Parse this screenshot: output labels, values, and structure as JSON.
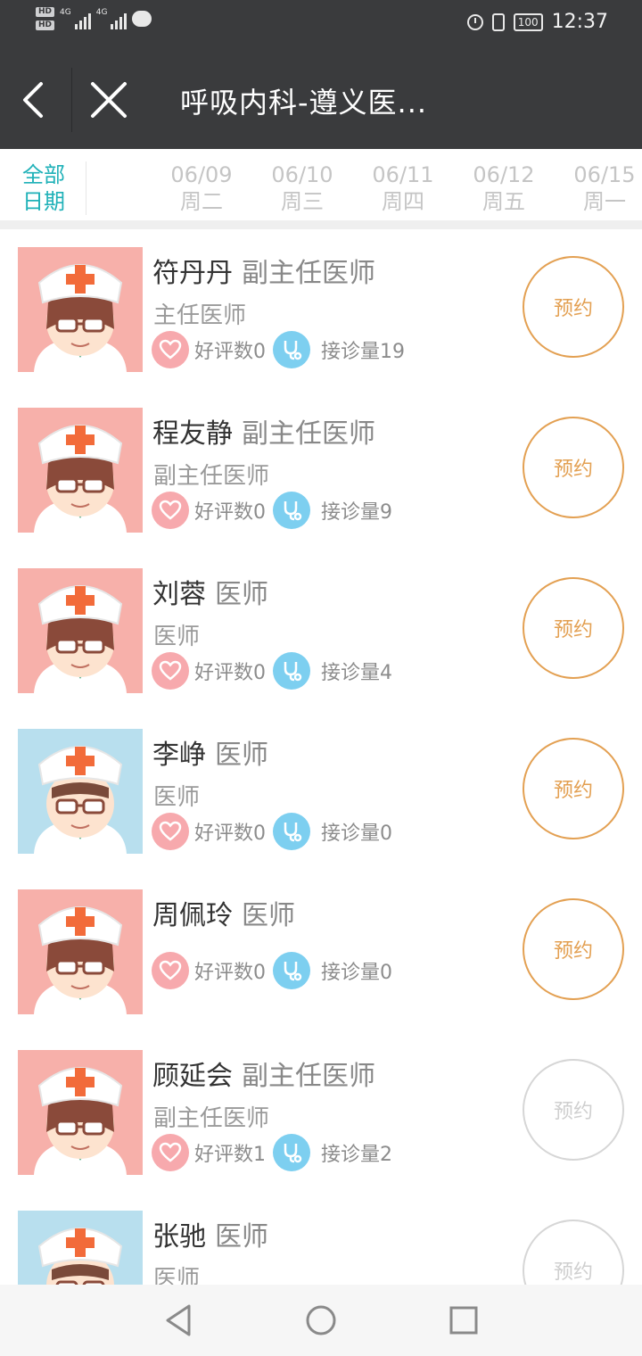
{
  "status_bar": {
    "hd1": "HD",
    "hd2": "HD",
    "net1": "4G",
    "net2": "4G",
    "battery": "100",
    "time": "12:37"
  },
  "header": {
    "title": "呼吸内科-遵义医..."
  },
  "date_bar": {
    "all_line1": "全部",
    "all_line2": "日期",
    "dates": [
      {
        "date": "06/09",
        "weekday": "周二"
      },
      {
        "date": "06/10",
        "weekday": "周三"
      },
      {
        "date": "06/11",
        "weekday": "周四"
      },
      {
        "date": "06/12",
        "weekday": "周五"
      },
      {
        "date": "06/15",
        "weekday": "周一"
      }
    ]
  },
  "doctors": [
    {
      "name": "符丹丹",
      "title": "副主任医师",
      "rank": "主任医师",
      "rating": "好评数0",
      "visits": "接诊量19",
      "book": "预约",
      "avatar": "female-doctor",
      "available": true
    },
    {
      "name": "程友静",
      "title": "副主任医师",
      "rank": "副主任医师",
      "rating": "好评数0",
      "visits": "接诊量9",
      "book": "预约",
      "avatar": "female-doctor",
      "available": true
    },
    {
      "name": "刘蓉",
      "title": "医师",
      "rank": "医师",
      "rating": "好评数0",
      "visits": "接诊量4",
      "book": "预约",
      "avatar": "female-doctor",
      "available": true
    },
    {
      "name": "李峥",
      "title": "医师",
      "rank": "医师",
      "rating": "好评数0",
      "visits": "接诊量0",
      "book": "预约",
      "avatar": "male-doctor",
      "available": true
    },
    {
      "name": "周佩玲",
      "title": "医师",
      "rank": "",
      "rating": "好评数0",
      "visits": "接诊量0",
      "book": "预约",
      "avatar": "female-doctor",
      "available": true
    },
    {
      "name": "顾延会",
      "title": "副主任医师",
      "rank": "副主任医师",
      "rating": "好评数1",
      "visits": "接诊量2",
      "book": "预约",
      "avatar": "female-doctor",
      "available": false
    },
    {
      "name": "张驰",
      "title": "医师",
      "rank": "医师",
      "rating": "",
      "visits": "",
      "book": "预约",
      "avatar": "male-doctor",
      "available": false
    }
  ],
  "colors": {
    "header_bg": "#3a3b3d",
    "accent_teal": "#1fb1b8",
    "book_orange": "#e3a052",
    "book_disabled": "#d6d6d6",
    "female_avatar_bg": "#f7b0aa",
    "male_avatar_bg": "#b8dfee",
    "heart_pink": "#f7a9ad",
    "steth_blue": "#7dcff0"
  },
  "icons": {
    "back": "chevron-left-icon",
    "close": "close-icon",
    "rating": "heart-icon",
    "visits": "stethoscope-icon",
    "nav_back": "triangle-back-icon",
    "nav_home": "circle-home-icon",
    "nav_recent": "square-recent-icon"
  }
}
